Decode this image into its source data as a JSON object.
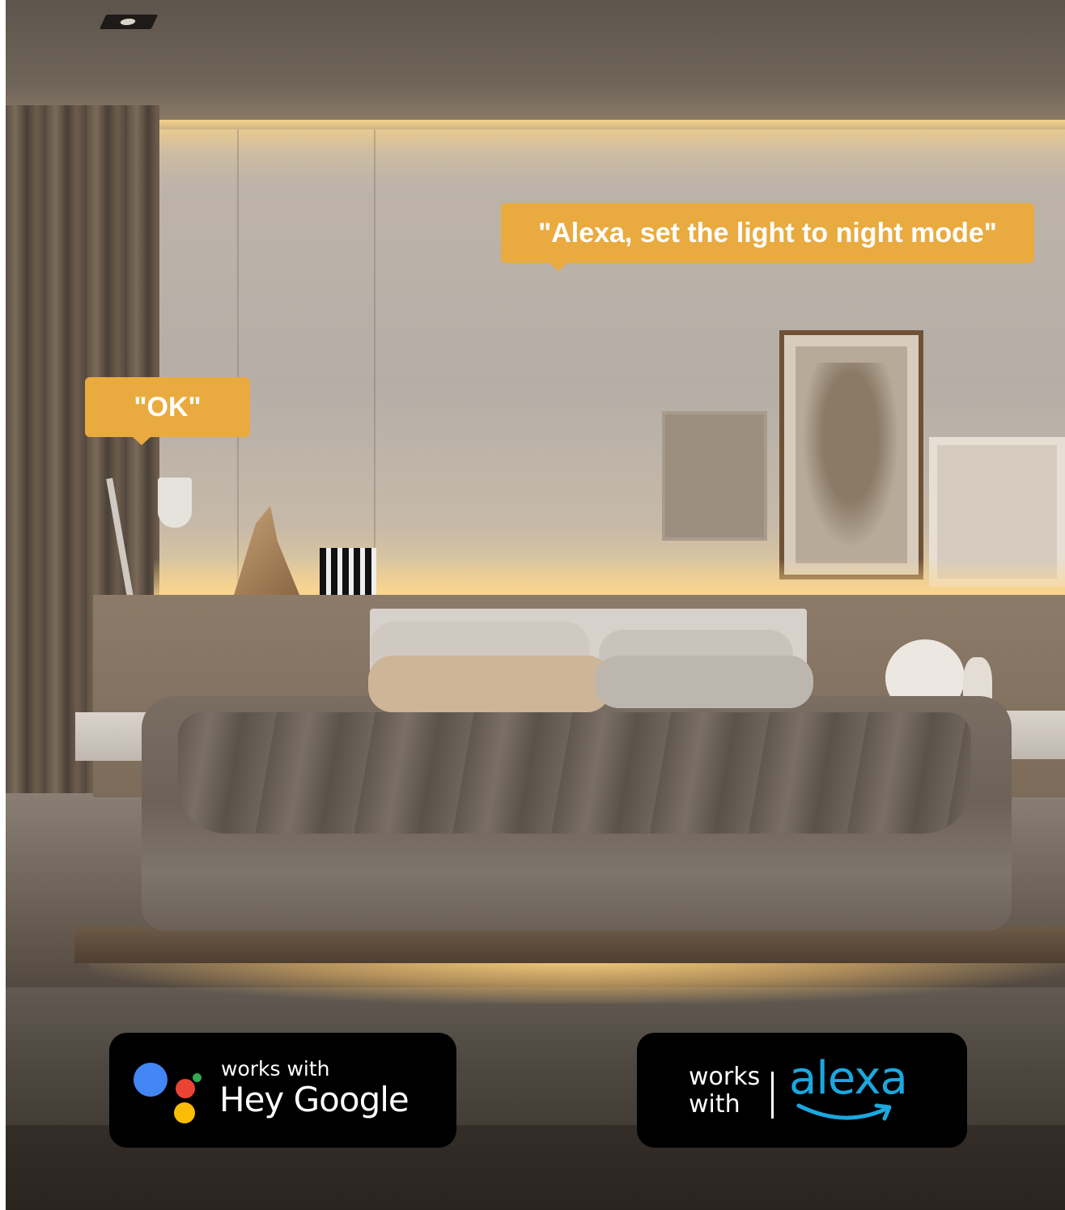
{
  "speech_bubbles": {
    "alexa_command": "\"Alexa, set the light to night mode\"",
    "response": "\"OK\""
  },
  "badges": {
    "google": {
      "small_text": "works with",
      "big_text": "Hey Google",
      "icon": "google-assistant-icon"
    },
    "alexa": {
      "works_text": "works with",
      "logo_text": "alexa",
      "icon": "amazon-smile-icon",
      "brand_color": "#1ba7df"
    }
  },
  "colors": {
    "bubble_accent": "#e9ab3f",
    "led_glow": "#f6d38c"
  }
}
